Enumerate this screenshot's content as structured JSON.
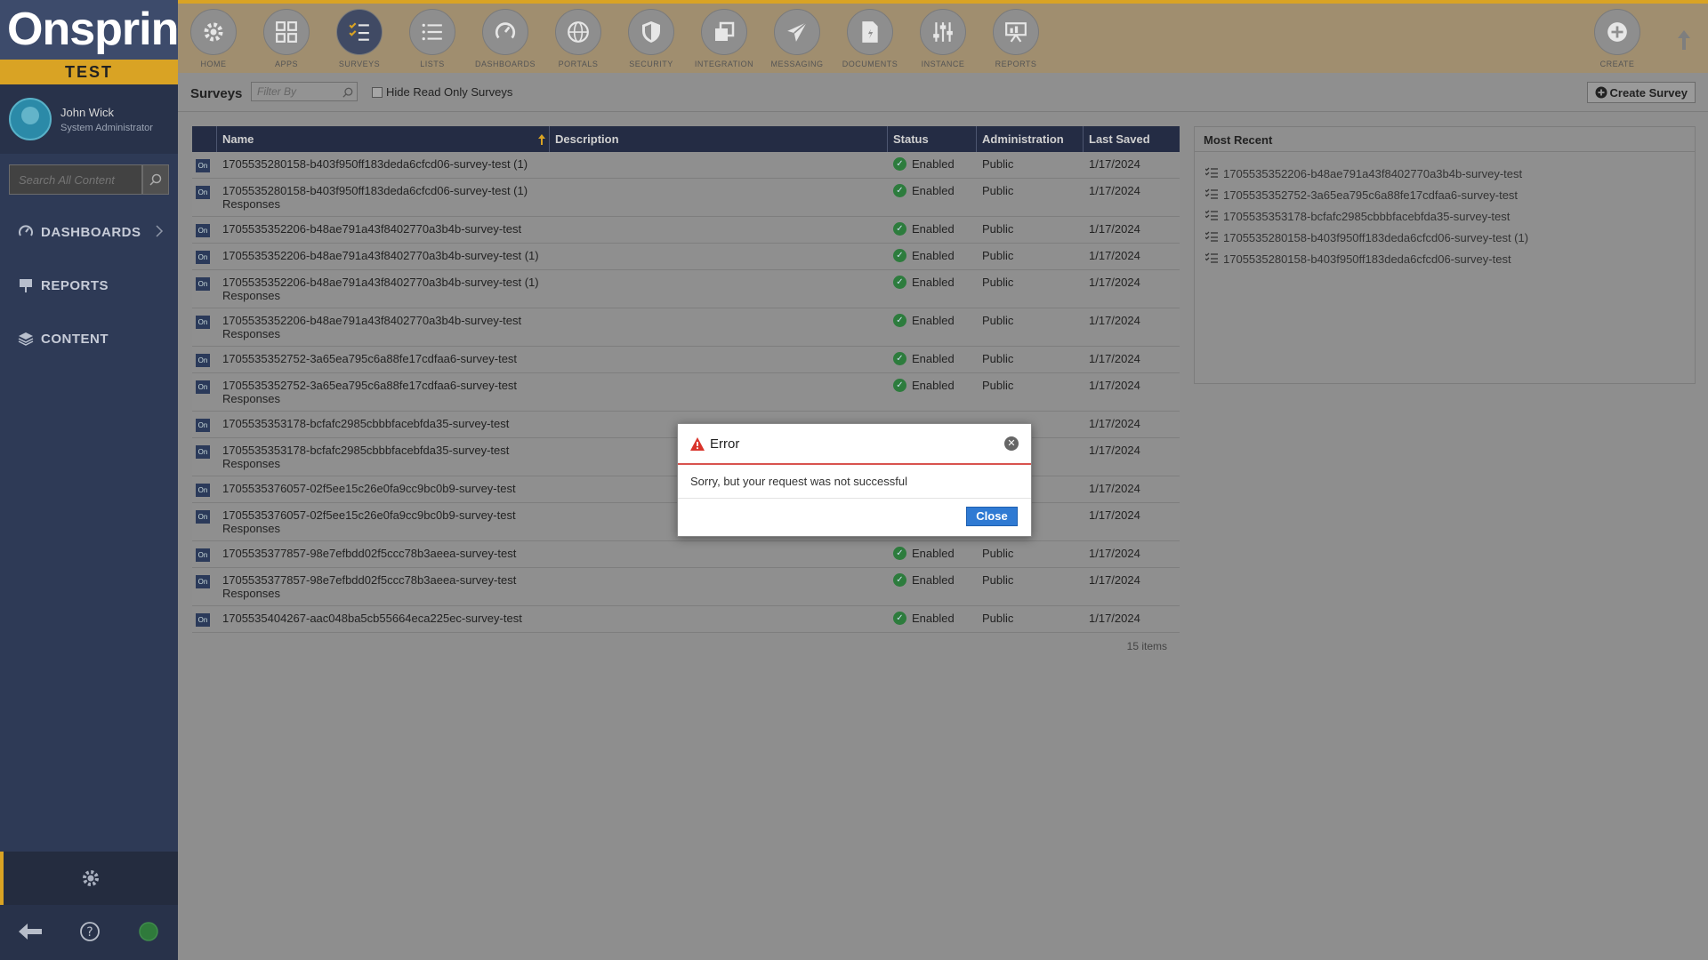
{
  "sidebar": {
    "logo": "Onspring",
    "environment": "TEST",
    "user": {
      "name": "John Wick",
      "role": "System Administrator"
    },
    "search_placeholder": "Search All Content",
    "nav": [
      {
        "label": "DASHBOARDS"
      },
      {
        "label": "REPORTS"
      },
      {
        "label": "CONTENT"
      }
    ]
  },
  "toolbar": {
    "items": [
      {
        "label": "HOME"
      },
      {
        "label": "APPS"
      },
      {
        "label": "SURVEYS"
      },
      {
        "label": "LISTS"
      },
      {
        "label": "DASHBOARDS"
      },
      {
        "label": "PORTALS"
      },
      {
        "label": "SECURITY"
      },
      {
        "label": "INTEGRATION"
      },
      {
        "label": "MESSAGING"
      },
      {
        "label": "DOCUMENTS"
      },
      {
        "label": "INSTANCE"
      },
      {
        "label": "REPORTS"
      },
      {
        "label": "CREATE"
      }
    ]
  },
  "subbar": {
    "title": "Surveys",
    "filter_placeholder": "Filter By",
    "hide_read_only": "Hide Read Only Surveys",
    "create_button": "Create Survey"
  },
  "grid": {
    "headers": {
      "name": "Name",
      "description": "Description",
      "status": "Status",
      "administration": "Administration",
      "last_saved": "Last Saved"
    },
    "on_label": "On",
    "rows": [
      {
        "name": "1705535280158-b403f950ff183deda6cfcd06-survey-test (1)",
        "sub": "",
        "status": "Enabled",
        "admin": "Public",
        "saved": "1/17/2024"
      },
      {
        "name": "1705535280158-b403f950ff183deda6cfcd06-survey-test (1)",
        "sub": "Responses",
        "status": "Enabled",
        "admin": "Public",
        "saved": "1/17/2024"
      },
      {
        "name": "1705535352206-b48ae791a43f8402770a3b4b-survey-test",
        "sub": "",
        "status": "Enabled",
        "admin": "Public",
        "saved": "1/17/2024"
      },
      {
        "name": "1705535352206-b48ae791a43f8402770a3b4b-survey-test (1)",
        "sub": "",
        "status": "Enabled",
        "admin": "Public",
        "saved": "1/17/2024"
      },
      {
        "name": "1705535352206-b48ae791a43f8402770a3b4b-survey-test (1)",
        "sub": "Responses",
        "status": "Enabled",
        "admin": "Public",
        "saved": "1/17/2024"
      },
      {
        "name": "1705535352206-b48ae791a43f8402770a3b4b-survey-test",
        "sub": "Responses",
        "status": "Enabled",
        "admin": "Public",
        "saved": "1/17/2024"
      },
      {
        "name": "1705535352752-3a65ea795c6a88fe17cdfaa6-survey-test",
        "sub": "",
        "status": "Enabled",
        "admin": "Public",
        "saved": "1/17/2024"
      },
      {
        "name": "1705535352752-3a65ea795c6a88fe17cdfaa6-survey-test",
        "sub": "Responses",
        "status": "Enabled",
        "admin": "Public",
        "saved": "1/17/2024"
      },
      {
        "name": "1705535353178-bcfafc2985cbbbfacebfda35-survey-test",
        "sub": "",
        "status": "",
        "admin": "",
        "saved": "1/17/2024"
      },
      {
        "name": "1705535353178-bcfafc2985cbbbfacebfda35-survey-test",
        "sub": "Responses",
        "status": "",
        "admin": "",
        "saved": "1/17/2024"
      },
      {
        "name": "1705535376057-02f5ee15c26e0fa9cc9bc0b9-survey-test",
        "sub": "",
        "status": "",
        "admin": "",
        "saved": "1/17/2024"
      },
      {
        "name": "1705535376057-02f5ee15c26e0fa9cc9bc0b9-survey-test",
        "sub": "Responses",
        "status": "",
        "admin": "",
        "saved": "1/17/2024"
      },
      {
        "name": "1705535377857-98e7efbdd02f5ccc78b3aeea-survey-test",
        "sub": "",
        "status": "Enabled",
        "admin": "Public",
        "saved": "1/17/2024"
      },
      {
        "name": "1705535377857-98e7efbdd02f5ccc78b3aeea-survey-test",
        "sub": "Responses",
        "status": "Enabled",
        "admin": "Public",
        "saved": "1/17/2024"
      },
      {
        "name": "1705535404267-aac048ba5cb55664eca225ec-survey-test",
        "sub": "",
        "status": "Enabled",
        "admin": "Public",
        "saved": "1/17/2024"
      }
    ],
    "count": "15 items"
  },
  "recent": {
    "title": "Most Recent",
    "items": [
      "1705535352206-b48ae791a43f8402770a3b4b-survey-test",
      "1705535352752-3a65ea795c6a88fe17cdfaa6-survey-test",
      "1705535353178-bcfafc2985cbbbfacebfda35-survey-test",
      "1705535280158-b403f950ff183deda6cfcd06-survey-test (1)",
      "1705535280158-b403f950ff183deda6cfcd06-survey-test"
    ]
  },
  "modal": {
    "title": "Error",
    "message": "Sorry, but your request was not successful",
    "close_button": "Close"
  },
  "colors": {
    "accent": "#d9a324",
    "sidebar": "#2e3a56",
    "header": "#242c44",
    "error": "#d9534f",
    "primary_button": "#2f7ad3",
    "enabled": "#2d7c3d"
  },
  "icons": {
    "toolbar": [
      "gear-icon",
      "apps-icon",
      "surveys-icon",
      "list-icon",
      "dashboard-icon",
      "globe-icon",
      "shield-icon",
      "integration-icon",
      "paper-plane-icon",
      "document-icon",
      "sliders-icon",
      "report-icon",
      "plus-icon"
    ]
  }
}
